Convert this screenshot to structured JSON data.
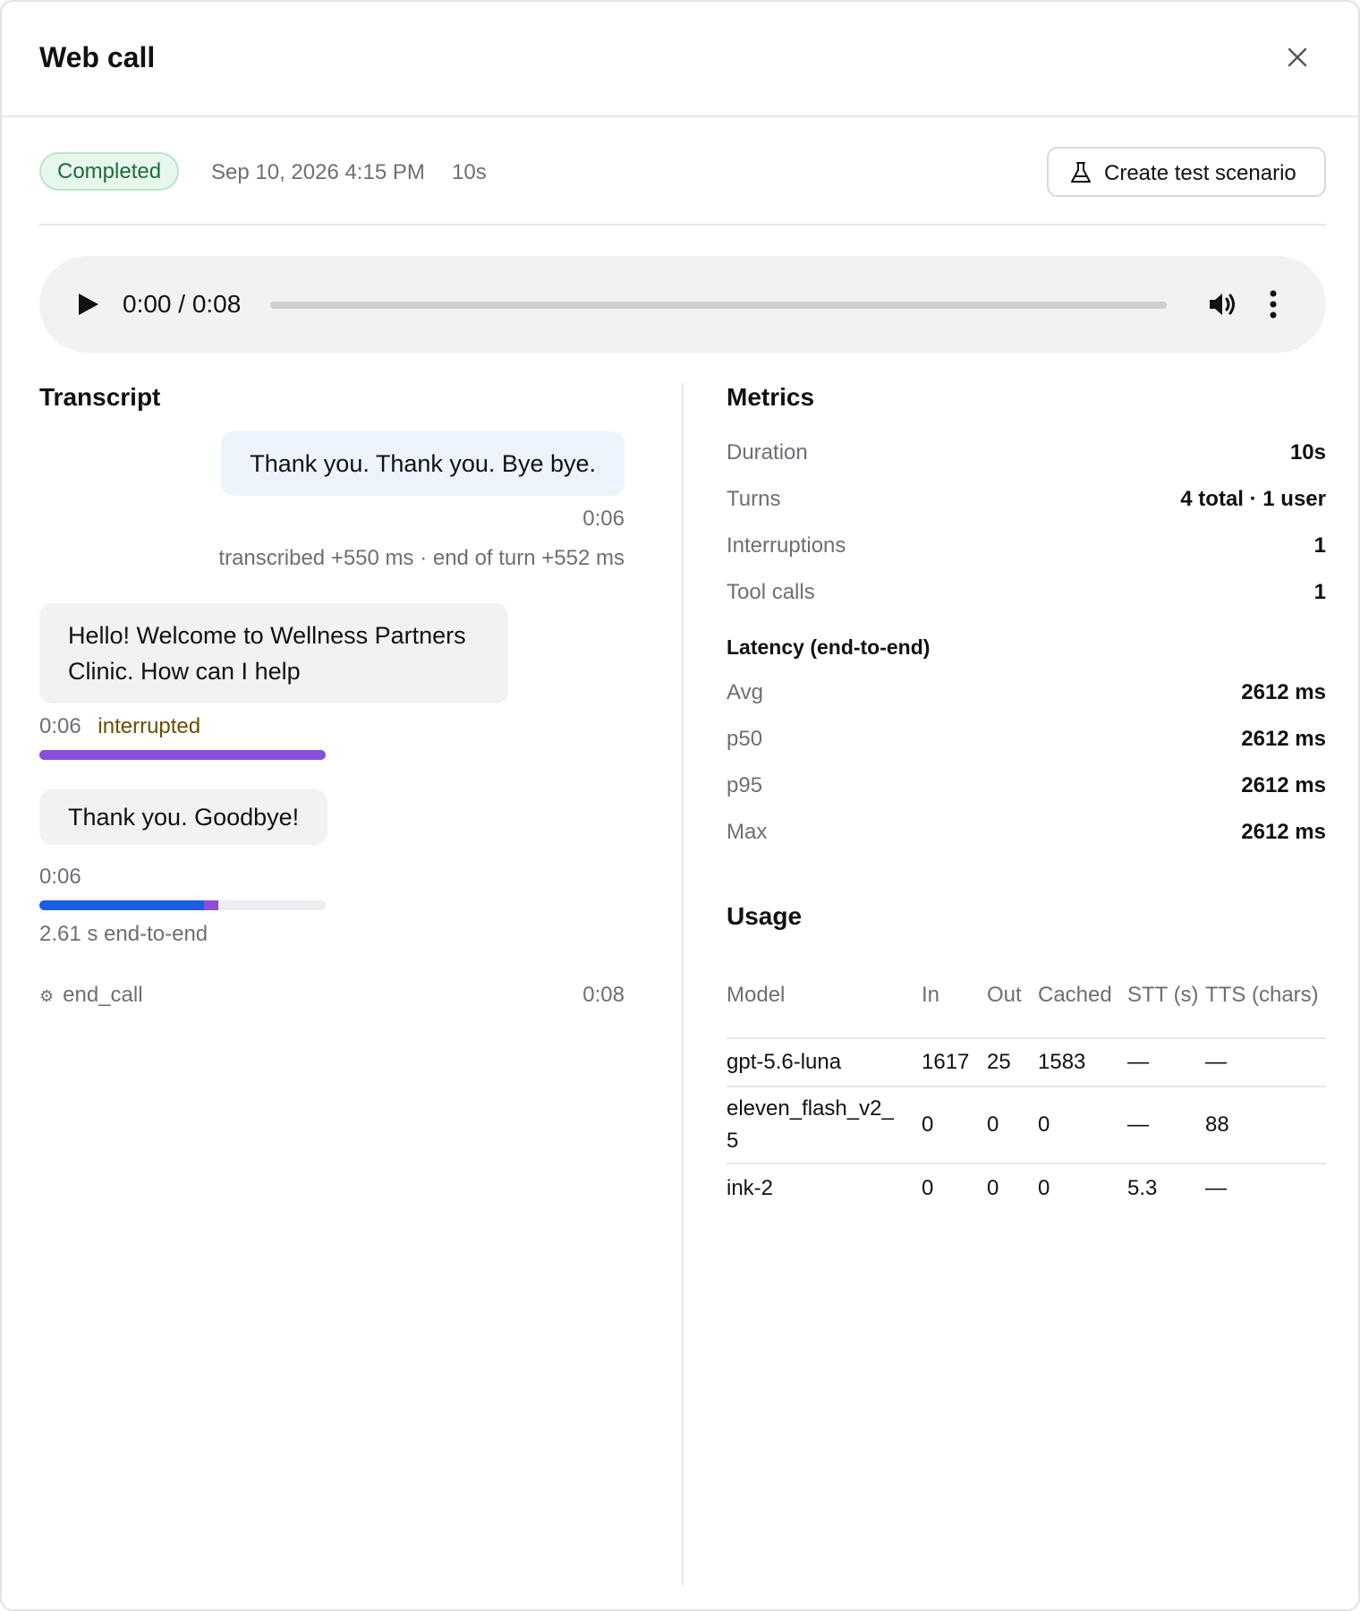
{
  "header": {
    "title": "Web call"
  },
  "status": {
    "badge": "Completed",
    "date": "Sep 10, 2026 4:15 PM",
    "duration": "10s",
    "test_button": "Create test scenario"
  },
  "player": {
    "time": "0:00 / 0:08",
    "progress": 0
  },
  "transcript": {
    "title": "Transcript",
    "user_message": {
      "text": "Thank you. Thank you. Bye bye.",
      "time": "0:06",
      "detail": "transcribed +550 ms · end of turn +552 ms"
    },
    "agent_message_1": {
      "text": "Hello! Welcome to Wellness Partners Clinic. How can I help",
      "time": "0:06",
      "tag": "interrupted"
    },
    "agent_message_2": {
      "text": "Thank you. Goodbye!",
      "time": "0:06",
      "latency": "2.61 s end-to-end"
    },
    "tool_call": {
      "name": "end_call",
      "time": "0:08"
    }
  },
  "metrics": {
    "title": "Metrics",
    "rows": [
      {
        "label": "Duration",
        "value": "10s"
      },
      {
        "label": "Turns",
        "value": "4 total · 1 user"
      },
      {
        "label": "Interruptions",
        "value": "1"
      },
      {
        "label": "Tool calls",
        "value": "1"
      }
    ],
    "latency_title": "Latency (end-to-end)",
    "latency": [
      {
        "label": "Avg",
        "value": "2612 ms"
      },
      {
        "label": "p50",
        "value": "2612 ms"
      },
      {
        "label": "p95",
        "value": "2612 ms"
      },
      {
        "label": "Max",
        "value": "2612 ms"
      }
    ]
  },
  "usage": {
    "title": "Usage",
    "columns": [
      "Model",
      "In",
      "Out",
      "Cached",
      "STT (s)",
      "TTS (chars)"
    ],
    "rows": [
      [
        "gpt-5.6-luna",
        "1617",
        "25",
        "1583",
        "—",
        "—"
      ],
      [
        "eleven_flash_v2_5",
        "0",
        "0",
        "0",
        "—",
        "88"
      ],
      [
        "ink-2",
        "0",
        "0",
        "0",
        "5.3",
        "—"
      ]
    ]
  },
  "colors": {
    "purple": "#8a4fd8",
    "blue": "#1a5fe0",
    "bar_bg": "#eceef2"
  }
}
